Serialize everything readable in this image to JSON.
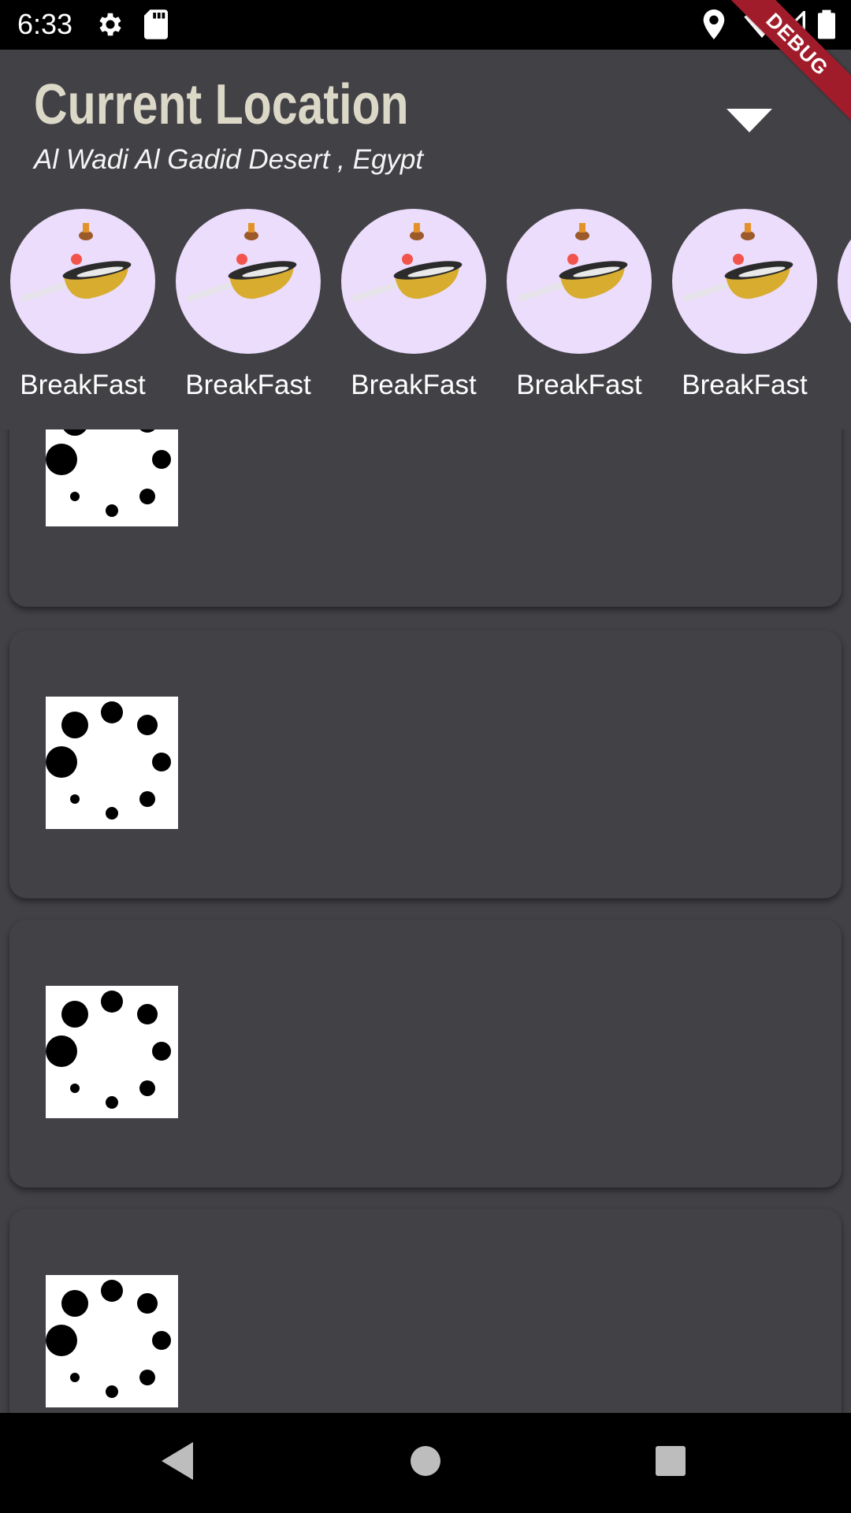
{
  "status_bar": {
    "time": "6:33",
    "icons": [
      "settings-icon",
      "sd-card-icon",
      "location-icon",
      "wifi-icon",
      "signal-icon",
      "battery-icon"
    ]
  },
  "debug_banner": "DEBUG",
  "header": {
    "title": "Current Location",
    "location": "Al Wadi Al Gadid Desert ,  Egypt",
    "dropdown_icon": "caret-down-icon"
  },
  "categories": [
    {
      "label": "BreakFast",
      "icon": "frying-pan-icon"
    },
    {
      "label": "BreakFast",
      "icon": "frying-pan-icon"
    },
    {
      "label": "BreakFast",
      "icon": "frying-pan-icon"
    },
    {
      "label": "BreakFast",
      "icon": "frying-pan-icon"
    },
    {
      "label": "BreakFast",
      "icon": "frying-pan-icon"
    }
  ],
  "list_items": [
    {
      "image": "loading-spinner-icon"
    },
    {
      "image": "loading-spinner-icon"
    },
    {
      "image": "loading-spinner-icon"
    },
    {
      "image": "loading-spinner-icon"
    }
  ],
  "nav_bar": [
    "back-icon",
    "home-icon",
    "recents-icon"
  ],
  "colors": {
    "background": "#424146",
    "title": "#dcd8c8",
    "category_circle": "#ebddfb",
    "debug": "#a11c2b"
  }
}
